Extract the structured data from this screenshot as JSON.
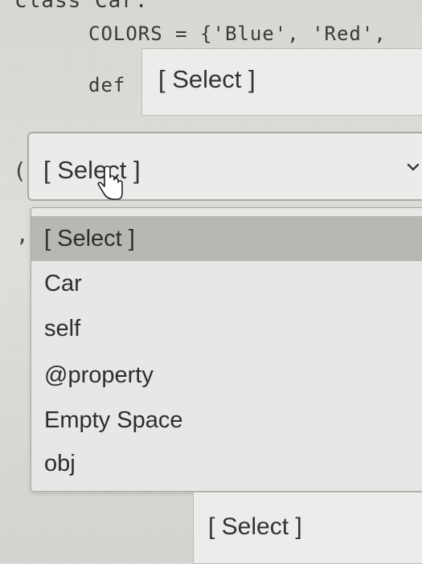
{
  "code": {
    "line1": "class Car:",
    "line2": "COLORS = {'Blue', 'Red',",
    "line3": "def"
  },
  "punctuation": {
    "paren": "(",
    "comma": ","
  },
  "def_box": {
    "label": "[ Select ]"
  },
  "main_select": {
    "value": "[ Select ]",
    "options": [
      {
        "label": "[ Select ]",
        "selected": true
      },
      {
        "label": "Car"
      },
      {
        "label": "self"
      },
      {
        "label": "@property"
      },
      {
        "label": "Empty Space"
      },
      {
        "label": "obj"
      }
    ]
  },
  "bottom_box": {
    "label": "[ Select ]"
  },
  "icons": {
    "dropdown_arrow": "chevron-down-icon",
    "pointer": "hand-cursor-icon"
  },
  "colors": {
    "highlight": "#b7b7b3",
    "background": "#d6d6d2",
    "field": "#ebebe9"
  }
}
